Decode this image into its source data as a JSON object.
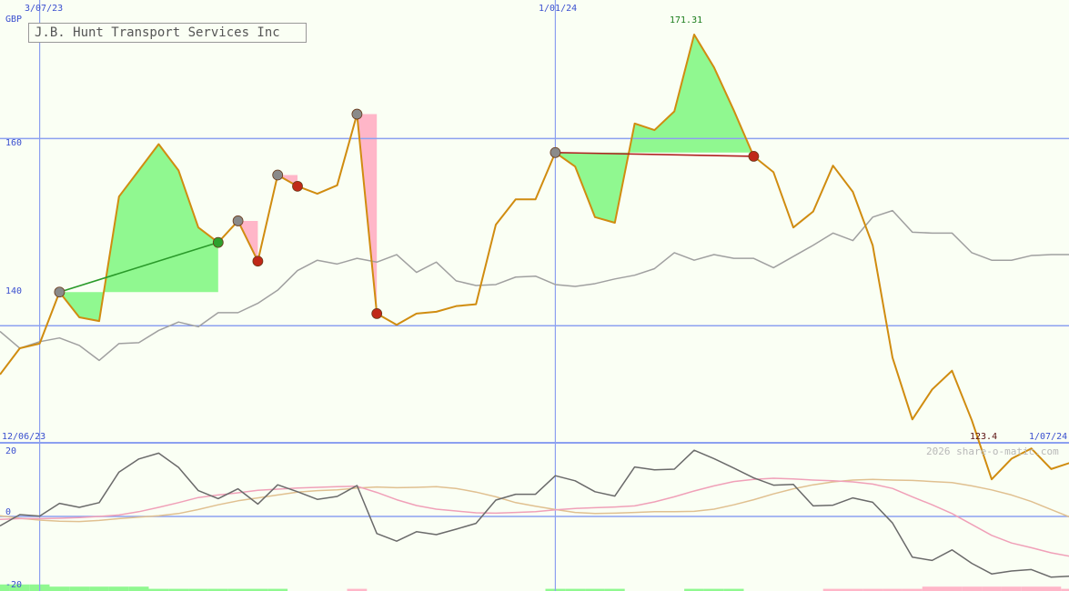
{
  "title": "J.B. Hunt Transport Services Inc",
  "currency": "GBP",
  "credit": "2026 share-o-matic.com",
  "colors": {
    "price": "#d08c10",
    "moving_average": "#a0a0a0",
    "gain_fill": "#90f890",
    "loss_fill": "#ffb6c8",
    "momentum": "#6a6a6a",
    "signal_pink": "#f0a0b8",
    "signal_tan": "#e0c090",
    "grid": "#8ca0f0"
  },
  "chart_data": [
    {
      "type": "line",
      "title": "J.B. Hunt Transport Services Inc",
      "ylabel": "GBP",
      "ylim": [
        127.6,
        174.5
      ],
      "y_ticks": [
        140,
        160
      ],
      "y_tick_labels": [
        "140",
        "160"
      ],
      "date_labels": [
        {
          "label": "3/07/23",
          "index": 2
        },
        {
          "label": "1/01/24",
          "index": 28
        },
        {
          "label": "12/06/23",
          "index": 0
        },
        {
          "label": "1/07/24",
          "index": 53
        }
      ],
      "annotations": {
        "max": "171.31",
        "min": "123.4"
      },
      "series": [
        {
          "values": [
            134.8,
            137.6,
            138.1,
            143.6,
            140.9,
            140.5,
            153.8,
            156.6,
            159.4,
            156.6,
            150.5,
            148.9,
            151.2,
            146.9,
            156.1,
            154.9,
            154.1,
            155.0,
            162.6,
            141.3,
            140.1,
            141.3,
            141.5,
            142.1,
            142.3,
            150.8,
            153.5,
            153.5,
            158.5,
            157.0,
            151.6,
            151.0,
            161.6,
            160.9,
            162.9,
            171.1,
            167.6,
            163.0,
            158.1,
            156.4,
            150.5,
            152.2,
            157.1,
            154.3,
            148.6,
            136.6,
            130.0,
            133.2,
            135.2,
            129.9,
            123.6,
            125.8,
            126.9,
            124.7,
            125.4
          ]
        },
        {
          "values": [
            139.4,
            137.6,
            138.3,
            138.7,
            137.9,
            136.3,
            138.1,
            138.2,
            139.5,
            140.4,
            139.9,
            141.4,
            141.4,
            142.4,
            143.8,
            145.9,
            147.0,
            146.6,
            147.2,
            146.8,
            147.6,
            145.7,
            146.8,
            144.8,
            144.3,
            144.4,
            145.2,
            145.3,
            144.4,
            144.2,
            144.5,
            145.0,
            145.4,
            146.1,
            147.8,
            147.0,
            147.6,
            147.2,
            147.2,
            146.2,
            147.4,
            148.6,
            149.9,
            149.1,
            151.6,
            152.3,
            150.0,
            149.9,
            149.9,
            147.8,
            147.0,
            147.0,
            147.5,
            147.6,
            147.6
          ]
        }
      ],
      "gain_trades": [
        {
          "buy_index": 3,
          "buy_price": 143.6,
          "sell_index": 11,
          "sell_price": 148.9
        },
        {
          "buy_index": 28,
          "buy_price": 158.5,
          "sell_index": 38,
          "sell_price": 158.1
        }
      ],
      "loss_trades": [
        {
          "buy_index": 12,
          "buy_price": 151.2,
          "sell_index": 13,
          "sell_price": 146.9
        },
        {
          "buy_index": 14,
          "buy_price": 156.1,
          "sell_index": 15,
          "sell_price": 154.9
        },
        {
          "buy_index": 18,
          "buy_price": 162.6,
          "sell_index": 19,
          "sell_price": 141.3
        }
      ]
    },
    {
      "type": "line",
      "ylim": [
        -20,
        20
      ],
      "y_ticks": [
        -20,
        0,
        20
      ],
      "y_tick_labels": [
        "-20",
        "0",
        "20"
      ],
      "series": [
        {
          "values": [
            -2.6,
            0.5,
            0.1,
            3.6,
            2.5,
            3.8,
            12.2,
            15.8,
            17.4,
            13.5,
            7.1,
            4.9,
            7.6,
            3.4,
            8.7,
            6.8,
            4.7,
            5.5,
            8.5,
            -4.7,
            -6.8,
            -4.2,
            -5.0,
            -3.5,
            -1.9,
            4.5,
            6.1,
            6.1,
            11.2,
            9.8,
            6.8,
            5.6,
            13.6,
            12.8,
            13.0,
            18.2,
            15.9,
            13.3,
            10.6,
            8.6,
            8.8,
            2.9,
            3.1,
            5.1,
            3.9,
            -1.8,
            -11.2,
            -12.1,
            -9.2,
            -12.9,
            -15.8,
            -15.0,
            -14.6,
            -16.7,
            -16.4
          ]
        },
        {
          "values": [
            -0.8,
            -0.6,
            -0.6,
            -0.5,
            -0.3,
            0.0,
            0.4,
            1.3,
            2.5,
            3.8,
            5.2,
            5.9,
            6.5,
            7.2,
            7.5,
            7.8,
            8.0,
            8.2,
            8.3,
            6.6,
            4.6,
            3.0,
            2.0,
            1.5,
            1.0,
            0.9,
            1.1,
            1.3,
            1.8,
            2.2,
            2.4,
            2.6,
            2.9,
            4.0,
            5.4,
            7.0,
            8.4,
            9.6,
            10.2,
            10.5,
            10.3,
            10.0,
            9.8,
            9.5,
            8.9,
            7.7,
            5.4,
            3.2,
            0.8,
            -2.2,
            -5.2,
            -7.3,
            -8.6,
            -10.0,
            -11.0
          ]
        },
        {
          "values": [
            0.2,
            -0.5,
            -1.0,
            -1.3,
            -1.4,
            -1.1,
            -0.6,
            -0.2,
            0.2,
            0.8,
            1.9,
            3.2,
            4.3,
            5.1,
            5.9,
            6.7,
            7.1,
            7.3,
            7.8,
            8.1,
            7.9,
            8.0,
            8.2,
            7.7,
            6.7,
            5.4,
            3.8,
            2.8,
            1.9,
            1.1,
            0.8,
            0.9,
            1.1,
            1.3,
            1.3,
            1.4,
            2.0,
            3.2,
            4.6,
            6.2,
            7.6,
            8.7,
            9.5,
            10.0,
            10.2,
            10.0,
            9.9,
            9.6,
            9.3,
            8.4,
            7.3,
            5.9,
            4.1,
            1.9,
            -0.3
          ]
        }
      ],
      "bars": [
        3,
        3,
        3,
        2,
        2,
        2,
        2,
        2,
        1,
        1,
        1,
        1,
        1,
        1,
        1,
        0,
        0,
        0,
        -1,
        0,
        0,
        0,
        0,
        0,
        0,
        0,
        0,
        0,
        1,
        1,
        1,
        1,
        0,
        0,
        0,
        1,
        1,
        1,
        0,
        0,
        0,
        0,
        -1,
        -1,
        -1,
        -1,
        -1,
        -2,
        -2,
        -2,
        -2,
        -2,
        -2,
        -2,
        -1
      ]
    }
  ]
}
